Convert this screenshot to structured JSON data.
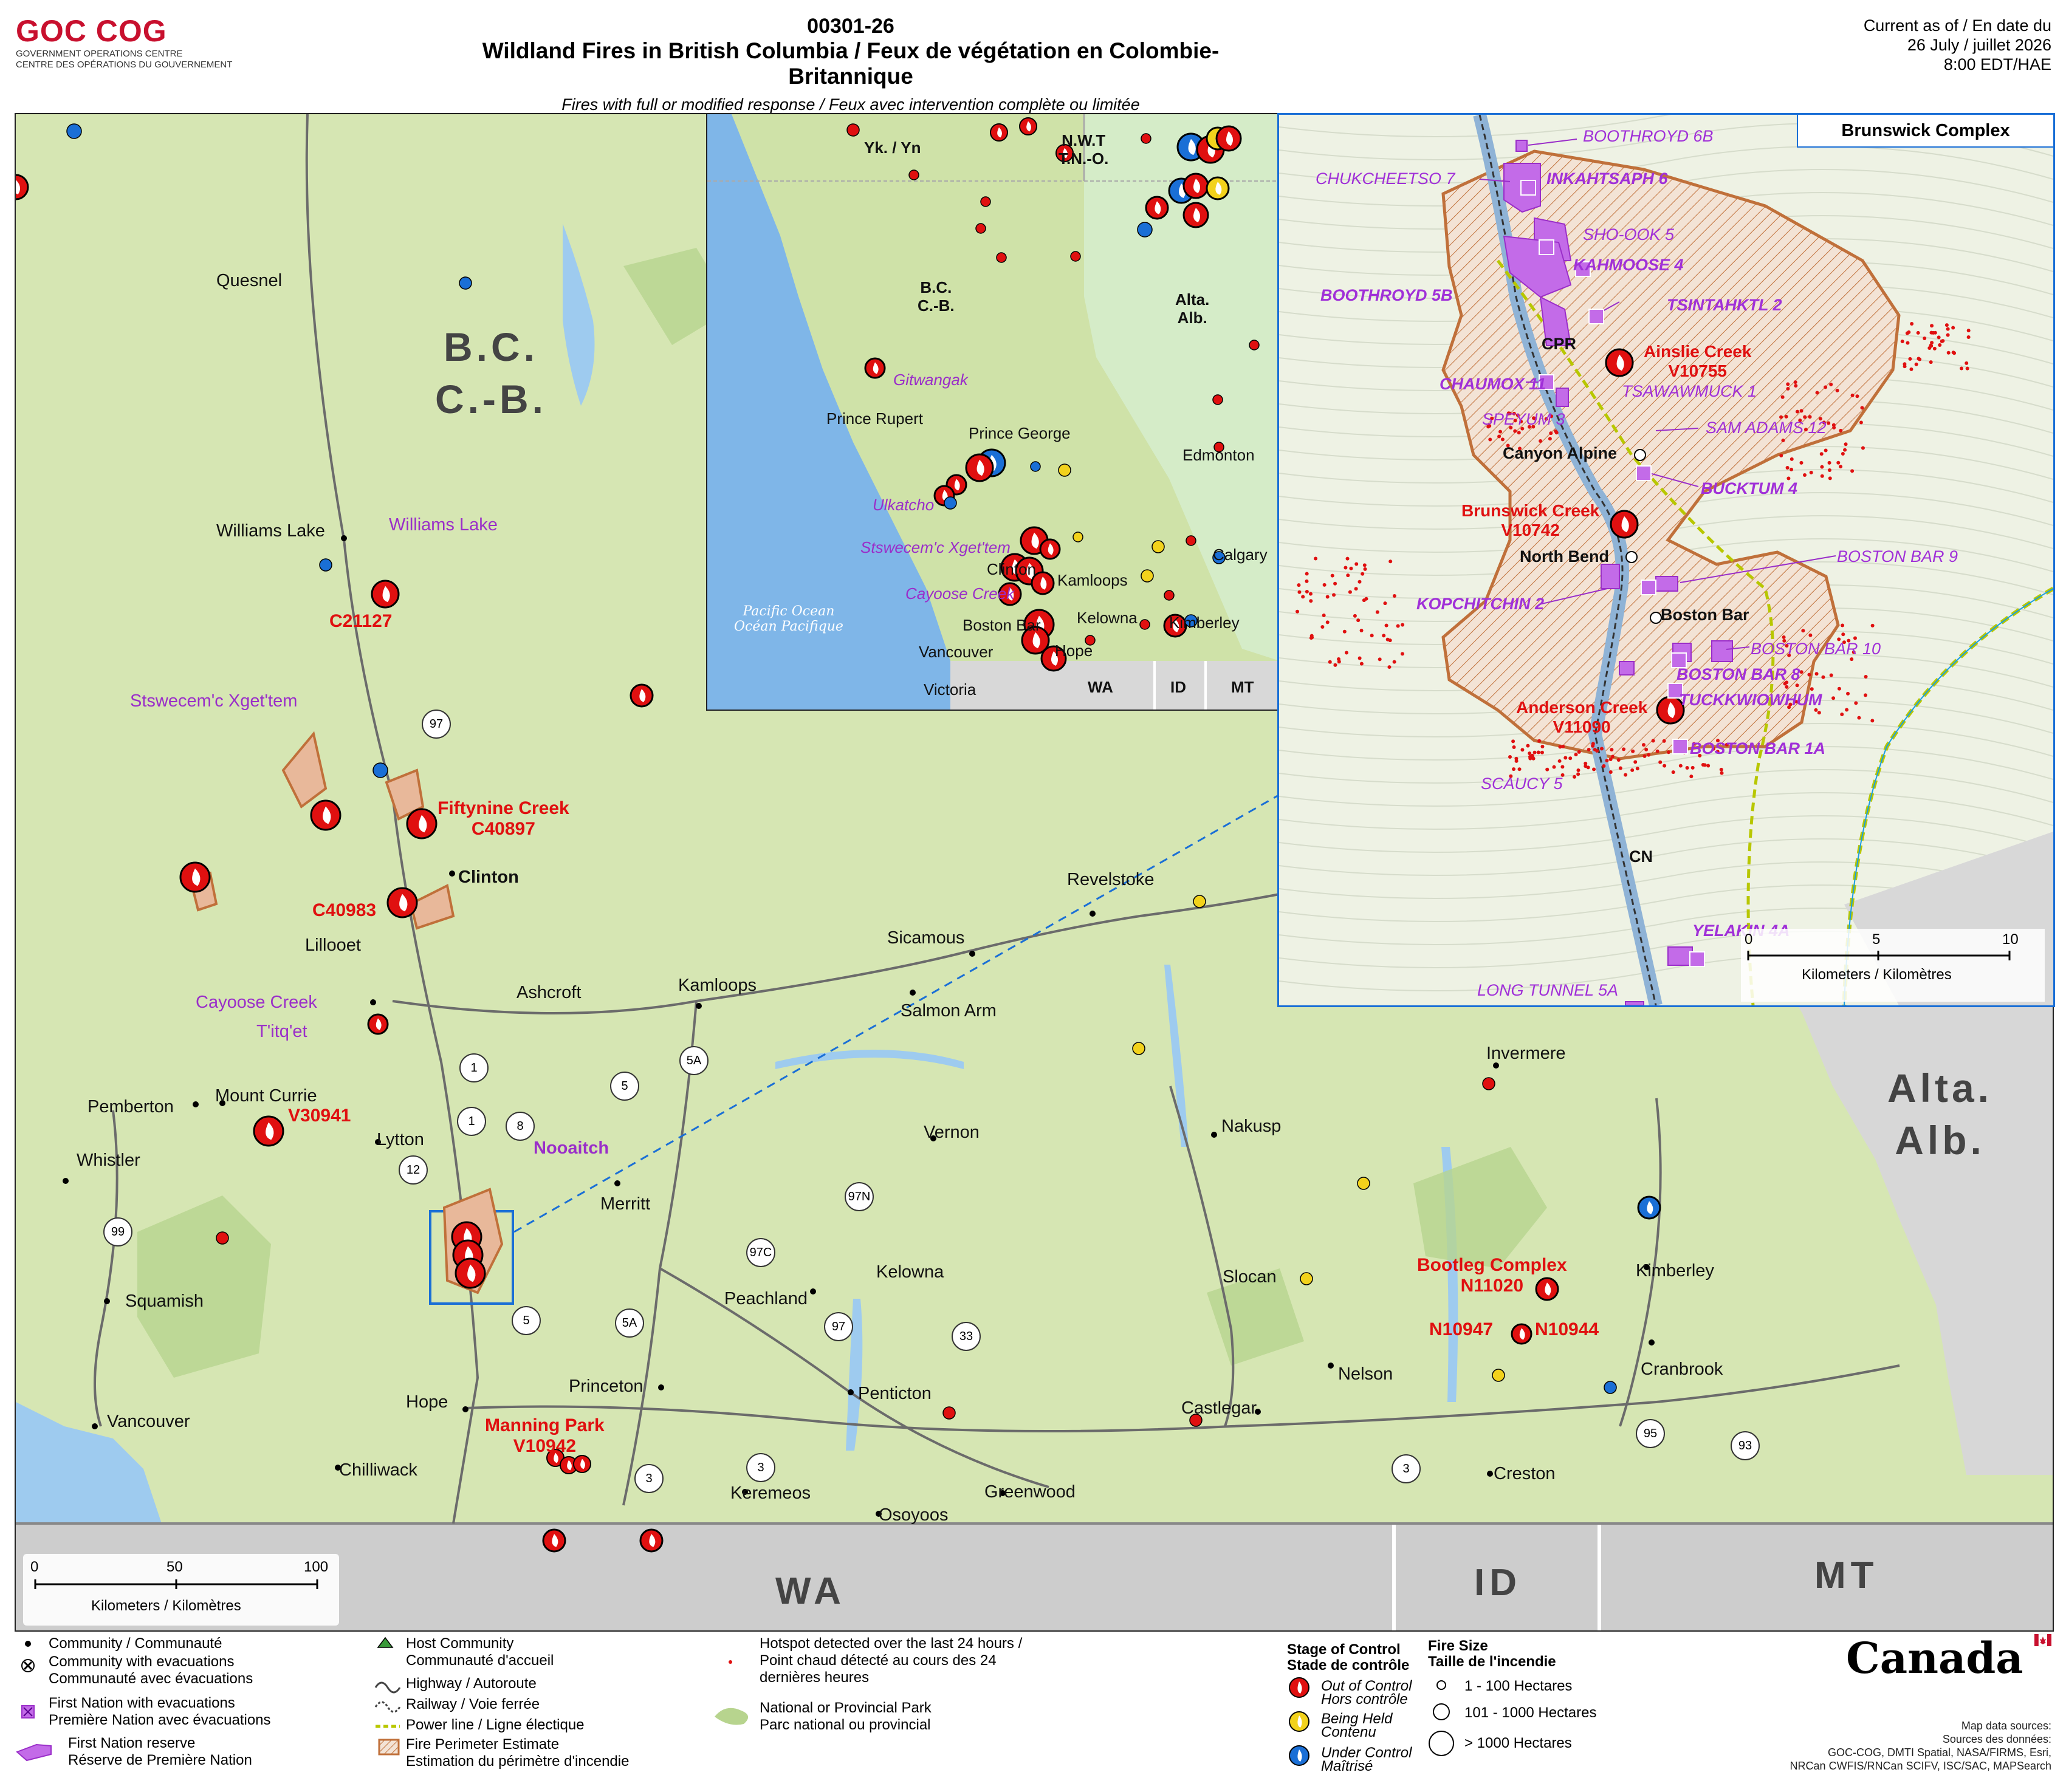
{
  "header": {
    "logo_text": "GOC COG",
    "org_en": "GOVERNMENT OPERATIONS CENTRE",
    "org_fr": "CENTRE DES OPÉRATIONS DU GOUVERNEMENT",
    "map_code": "00301-26",
    "title": "Wildland Fires in British Columbia / Feux de végétation en Colombie-Britannique",
    "subtitle": "Fires with full or modified response / Feux avec intervention complète ou limitée",
    "current_as_of": "Current as of / En date du",
    "date": "26 July / juillet 2026",
    "time": "8:00 EDT/HAE"
  },
  "colors": {
    "land": "#d6e6b3",
    "water": "#9ecbef",
    "outside": "#cfcfcf",
    "fire_out_of_control": "#e01010",
    "being_held": "#f2d21c",
    "under_control": "#1a6fd6",
    "first_nation": "#a030d8",
    "perimeter": "#c0703a"
  },
  "main_map": {
    "province_label": [
      "B.C.",
      "C.-B."
    ],
    "alberta_label": [
      "Alta.",
      "Alb."
    ],
    "states": [
      "WA",
      "ID",
      "MT"
    ],
    "communities": [
      "Quesnel",
      "Williams Lake",
      "Clinton",
      "Lillooet",
      "Ashcroft",
      "Kamloops",
      "Sicamous",
      "Revelstoke",
      "Salmon Arm",
      "Pemberton",
      "Mount Currie",
      "Whistler",
      "Lytton",
      "Merritt",
      "Vernon",
      "Nakusp",
      "Invermere",
      "Squamish",
      "Kelowna",
      "Peachland",
      "Slocan",
      "Kimberley",
      "Cranbrook",
      "Nelson",
      "Castlegar",
      "Princeton",
      "Penticton",
      "Hope",
      "Vancouver",
      "Chilliwack",
      "Keremeos",
      "Osoyoos",
      "Greenwood",
      "Creston"
    ],
    "first_nations": [
      "Williams Lake",
      "Stswecem'c Xget'tem",
      "Cayoose Creek",
      "T'itq'et",
      "Nooaitch"
    ],
    "fires": [
      {
        "name": "",
        "id": "C21127"
      },
      {
        "name": "Fiftynine Creek",
        "id": "C40897"
      },
      {
        "name": "",
        "id": "C40983"
      },
      {
        "name": "",
        "id": "V30941"
      },
      {
        "name": "Bootleg Complex",
        "id": "N11020"
      },
      {
        "name": "",
        "id": "N10947"
      },
      {
        "name": "",
        "id": "N10944"
      },
      {
        "name": "Manning Park",
        "id": "V10942"
      }
    ],
    "highways": [
      "97",
      "12",
      "1",
      "8",
      "5",
      "5A",
      "99",
      "97N",
      "97C",
      "97",
      "33",
      "3",
      "95",
      "93",
      "1",
      "5A",
      "5",
      "3",
      "3"
    ],
    "scale": {
      "ticks": [
        "0",
        "50",
        "100"
      ],
      "unit": "Kilometers / Kilomètres"
    }
  },
  "overview_inset": {
    "labels": [
      "Yk. / Yn",
      "N.W.T",
      "T.N.-O.",
      "Prince Rupert",
      "Prince George",
      "Edmonton",
      "Calgary",
      "Clinton",
      "Kamloops",
      "Kelowna",
      "Kimberley",
      "Boston Bar",
      "Hope",
      "Vancouver",
      "Victoria"
    ],
    "province_label": [
      "B.C.",
      "C.-B."
    ],
    "alberta_label": [
      "Alta.",
      "Alb."
    ],
    "ocean": [
      "Pacific Ocean",
      "Océan Pacifique"
    ],
    "first_nations": [
      "Gitwangak",
      "Ulkatcho",
      "Stswecem'c Xget'tem",
      "Cayoose Creek"
    ],
    "states": [
      "WA",
      "ID",
      "MT"
    ]
  },
  "detail_inset": {
    "title": "Brunswick Complex",
    "reserves_bold": [
      "INKAHTSAPH 6",
      "KAHMOOSE 4",
      "BOOTHROYD 5B",
      "TSINTAHKTL 2",
      "CHAUMOX 11",
      "BUCKTUM 4",
      "KOPCHITCHIN 2",
      "BOSTON BAR 8",
      "TUCKKWIOWHUM",
      "BOSTON BAR 1A",
      "YELAKIN 4A"
    ],
    "reserves": [
      "BOOTHROYD 6B",
      "CHUKCHEETSO 7",
      "SHO-OOK 5",
      "TSAWAWMUCK 1",
      "SPEYUM 3",
      "SAM ADAMS 12",
      "BOSTON BAR 9",
      "BOSTON BAR 10",
      "SCAUCY 5",
      "LONG TUNNEL 5A"
    ],
    "places": [
      "CPR",
      "Canyon Alpine",
      "North Bend",
      "Boston Bar",
      "CN"
    ],
    "fires": [
      {
        "name": "Ainslie Creek",
        "id": "V10755"
      },
      {
        "name": "Brunswick Creek",
        "id": "V10742"
      },
      {
        "name": "Anderson Creek",
        "id": "V11090"
      }
    ],
    "scale": {
      "ticks": [
        "0",
        "5",
        "10"
      ],
      "unit": "Kilometers / Kilomètres"
    }
  },
  "legend": {
    "community": "Community / Communauté",
    "community_evac_en": "Community with evacuations",
    "community_evac_fr": "Communauté avec évacuations",
    "fn_evac_en": "First Nation with evacuations",
    "fn_evac_fr": "Première Nation avec évacuations",
    "fn_reserve_en": "First Nation reserve",
    "fn_reserve_fr": "Réserve de Première Nation",
    "host_en": "Host Community",
    "host_fr": "Communauté d'accueil",
    "highway": "Highway / Autoroute",
    "railway": "Railway / Voie ferrée",
    "powerline": "Power line / Ligne électique",
    "perimeter_en": "Fire Perimeter Estimate",
    "perimeter_fr": "Estimation du périmètre d'incendie",
    "hotspot_1": "Hotspot detected over the last 24 hours /",
    "hotspot_2": "Point chaud détecté au cours des 24",
    "hotspot_3": "dernières heures",
    "park_en": "National or Provincial Park",
    "park_fr": "Parc national ou provincial",
    "stage_en": "Stage of Control",
    "stage_fr": "Stade de contrôle",
    "out_en": "Out of Control",
    "out_fr": "Hors contrôle",
    "held_en": "Being Held",
    "held_fr": "Contenu",
    "under_en": "Under Control",
    "under_fr": "Maîtrisé",
    "size_en": "Fire Size",
    "size_fr": "Taille de l'incendie",
    "size_1": "1 - 100 Hectares",
    "size_2": "101 - 1000 Hectares",
    "size_3": "> 1000 Hectares"
  },
  "canada_wordmark": "Canada",
  "sources": [
    "Map data sources:",
    "Sources des données:",
    "GOC-COG, DMTI Spatial, NASA/FIRMS, Esri,",
    "NRCan CWFIS/RNCan SCIFV, ISC/SAC, MAPSearch"
  ]
}
